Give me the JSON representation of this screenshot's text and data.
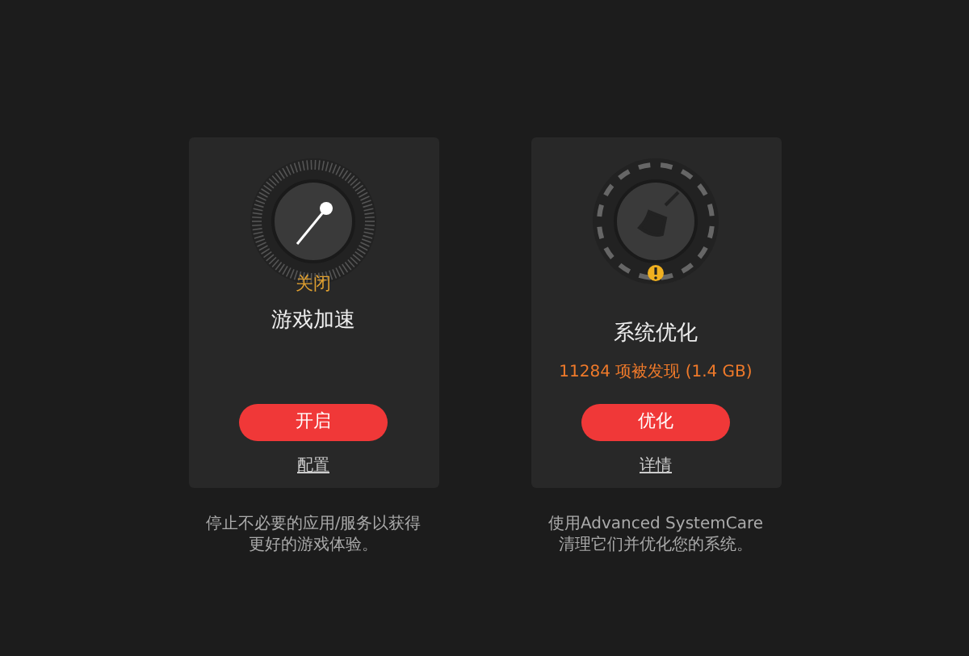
{
  "cards": [
    {
      "kind": "speed",
      "status": "关闭",
      "title": "游戏加速",
      "button": "开启",
      "link": "配置",
      "description": "停止不必要的应用/服务以获得更好的游戏体验。"
    },
    {
      "kind": "clean",
      "title": "系统优化",
      "found": "11284 项被发现 (1.4 GB)",
      "button": "优化",
      "link": "详情",
      "description": "使用Advanced SystemCare清理它们并优化您的系统。"
    }
  ]
}
